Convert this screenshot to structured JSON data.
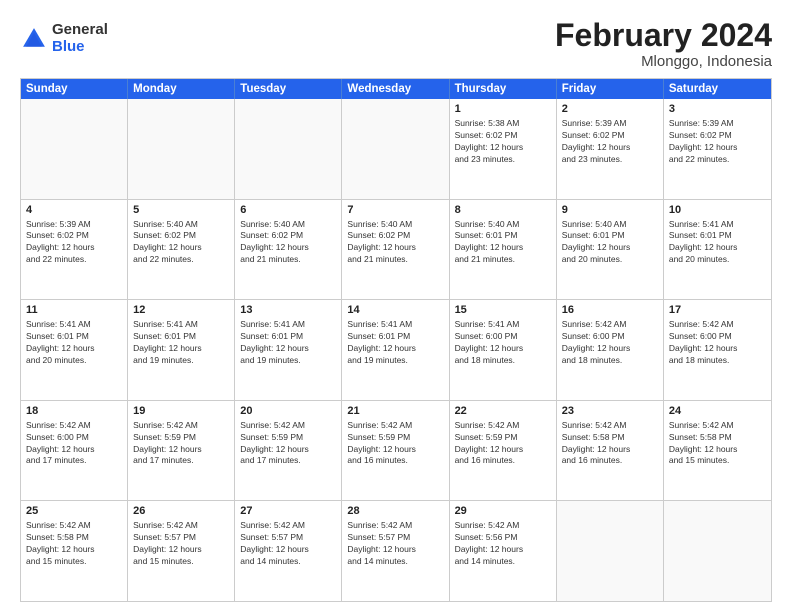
{
  "header": {
    "logo_general": "General",
    "logo_blue": "Blue",
    "month_title": "February 2024",
    "location": "Mlonggo, Indonesia"
  },
  "calendar": {
    "days": [
      "Sunday",
      "Monday",
      "Tuesday",
      "Wednesday",
      "Thursday",
      "Friday",
      "Saturday"
    ],
    "rows": [
      [
        {
          "day": "",
          "text": "",
          "empty": true
        },
        {
          "day": "",
          "text": "",
          "empty": true
        },
        {
          "day": "",
          "text": "",
          "empty": true
        },
        {
          "day": "",
          "text": "",
          "empty": true
        },
        {
          "day": "1",
          "text": "Sunrise: 5:38 AM\nSunset: 6:02 PM\nDaylight: 12 hours\nand 23 minutes."
        },
        {
          "day": "2",
          "text": "Sunrise: 5:39 AM\nSunset: 6:02 PM\nDaylight: 12 hours\nand 23 minutes."
        },
        {
          "day": "3",
          "text": "Sunrise: 5:39 AM\nSunset: 6:02 PM\nDaylight: 12 hours\nand 22 minutes."
        }
      ],
      [
        {
          "day": "4",
          "text": "Sunrise: 5:39 AM\nSunset: 6:02 PM\nDaylight: 12 hours\nand 22 minutes."
        },
        {
          "day": "5",
          "text": "Sunrise: 5:40 AM\nSunset: 6:02 PM\nDaylight: 12 hours\nand 22 minutes."
        },
        {
          "day": "6",
          "text": "Sunrise: 5:40 AM\nSunset: 6:02 PM\nDaylight: 12 hours\nand 21 minutes."
        },
        {
          "day": "7",
          "text": "Sunrise: 5:40 AM\nSunset: 6:02 PM\nDaylight: 12 hours\nand 21 minutes."
        },
        {
          "day": "8",
          "text": "Sunrise: 5:40 AM\nSunset: 6:01 PM\nDaylight: 12 hours\nand 21 minutes."
        },
        {
          "day": "9",
          "text": "Sunrise: 5:40 AM\nSunset: 6:01 PM\nDaylight: 12 hours\nand 20 minutes."
        },
        {
          "day": "10",
          "text": "Sunrise: 5:41 AM\nSunset: 6:01 PM\nDaylight: 12 hours\nand 20 minutes."
        }
      ],
      [
        {
          "day": "11",
          "text": "Sunrise: 5:41 AM\nSunset: 6:01 PM\nDaylight: 12 hours\nand 20 minutes."
        },
        {
          "day": "12",
          "text": "Sunrise: 5:41 AM\nSunset: 6:01 PM\nDaylight: 12 hours\nand 19 minutes."
        },
        {
          "day": "13",
          "text": "Sunrise: 5:41 AM\nSunset: 6:01 PM\nDaylight: 12 hours\nand 19 minutes."
        },
        {
          "day": "14",
          "text": "Sunrise: 5:41 AM\nSunset: 6:01 PM\nDaylight: 12 hours\nand 19 minutes."
        },
        {
          "day": "15",
          "text": "Sunrise: 5:41 AM\nSunset: 6:00 PM\nDaylight: 12 hours\nand 18 minutes."
        },
        {
          "day": "16",
          "text": "Sunrise: 5:42 AM\nSunset: 6:00 PM\nDaylight: 12 hours\nand 18 minutes."
        },
        {
          "day": "17",
          "text": "Sunrise: 5:42 AM\nSunset: 6:00 PM\nDaylight: 12 hours\nand 18 minutes."
        }
      ],
      [
        {
          "day": "18",
          "text": "Sunrise: 5:42 AM\nSunset: 6:00 PM\nDaylight: 12 hours\nand 17 minutes."
        },
        {
          "day": "19",
          "text": "Sunrise: 5:42 AM\nSunset: 5:59 PM\nDaylight: 12 hours\nand 17 minutes."
        },
        {
          "day": "20",
          "text": "Sunrise: 5:42 AM\nSunset: 5:59 PM\nDaylight: 12 hours\nand 17 minutes."
        },
        {
          "day": "21",
          "text": "Sunrise: 5:42 AM\nSunset: 5:59 PM\nDaylight: 12 hours\nand 16 minutes."
        },
        {
          "day": "22",
          "text": "Sunrise: 5:42 AM\nSunset: 5:59 PM\nDaylight: 12 hours\nand 16 minutes."
        },
        {
          "day": "23",
          "text": "Sunrise: 5:42 AM\nSunset: 5:58 PM\nDaylight: 12 hours\nand 16 minutes."
        },
        {
          "day": "24",
          "text": "Sunrise: 5:42 AM\nSunset: 5:58 PM\nDaylight: 12 hours\nand 15 minutes."
        }
      ],
      [
        {
          "day": "25",
          "text": "Sunrise: 5:42 AM\nSunset: 5:58 PM\nDaylight: 12 hours\nand 15 minutes."
        },
        {
          "day": "26",
          "text": "Sunrise: 5:42 AM\nSunset: 5:57 PM\nDaylight: 12 hours\nand 15 minutes."
        },
        {
          "day": "27",
          "text": "Sunrise: 5:42 AM\nSunset: 5:57 PM\nDaylight: 12 hours\nand 14 minutes."
        },
        {
          "day": "28",
          "text": "Sunrise: 5:42 AM\nSunset: 5:57 PM\nDaylight: 12 hours\nand 14 minutes."
        },
        {
          "day": "29",
          "text": "Sunrise: 5:42 AM\nSunset: 5:56 PM\nDaylight: 12 hours\nand 14 minutes."
        },
        {
          "day": "",
          "text": "",
          "empty": true
        },
        {
          "day": "",
          "text": "",
          "empty": true
        }
      ]
    ]
  }
}
